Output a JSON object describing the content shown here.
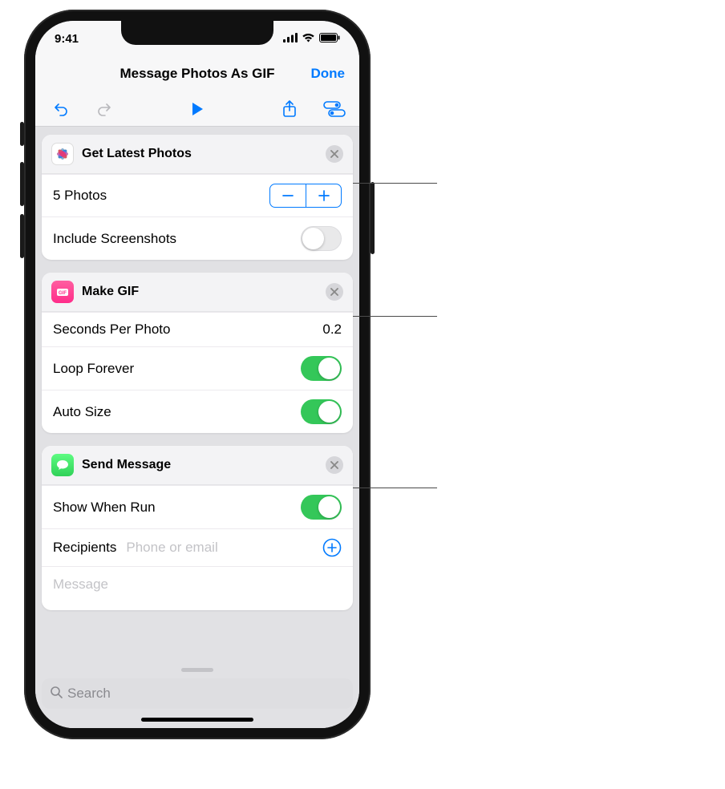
{
  "status": {
    "time": "9:41"
  },
  "nav": {
    "title": "Message Photos As GIF",
    "done": "Done"
  },
  "actions": [
    {
      "id": "get-latest-photos",
      "title": "Get Latest Photos",
      "icon": "photos",
      "rows": {
        "count_label": "5 Photos",
        "include_screenshots_label": "Include Screenshots",
        "include_screenshots_on": false
      }
    },
    {
      "id": "make-gif",
      "title": "Make GIF",
      "icon": "gif",
      "rows": {
        "seconds_label": "Seconds Per Photo",
        "seconds_value": "0.2",
        "loop_label": "Loop Forever",
        "loop_on": true,
        "autosize_label": "Auto Size",
        "autosize_on": true
      }
    },
    {
      "id": "send-message",
      "title": "Send Message",
      "icon": "messages",
      "rows": {
        "show_when_run_label": "Show When Run",
        "show_when_run_on": true,
        "recipients_label": "Recipients",
        "recipients_placeholder": "Phone or email",
        "message_placeholder": "Message"
      }
    }
  ],
  "search": {
    "placeholder": "Search"
  }
}
